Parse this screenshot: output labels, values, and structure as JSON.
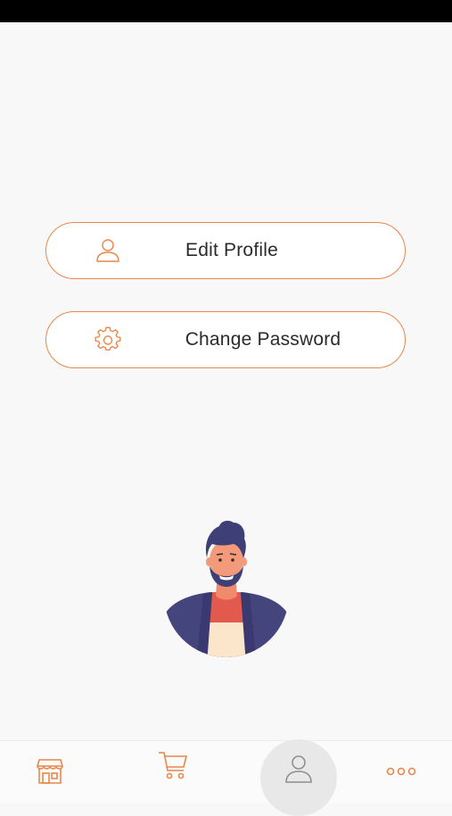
{
  "menu": {
    "edit_profile": {
      "label": "Edit Profile",
      "icon": "user-icon"
    },
    "change_password": {
      "label": "Change Password",
      "icon": "gear-icon"
    }
  },
  "illustration": {
    "icon": "user-avatar-illustration"
  },
  "bottom_nav": {
    "items": [
      {
        "icon": "store-icon",
        "active": false
      },
      {
        "icon": "cart-icon",
        "active": false
      },
      {
        "icon": "user-icon",
        "active": true
      },
      {
        "icon": "more-icon",
        "active": false
      }
    ]
  },
  "colors": {
    "accent": "#e8874a",
    "background": "#f8f8f8",
    "text": "#2b2b2b",
    "active_tab_bg": "#e8e8e8"
  }
}
